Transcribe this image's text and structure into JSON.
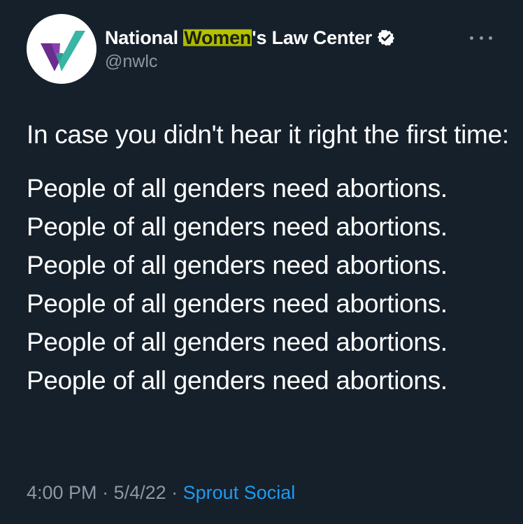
{
  "author": {
    "name_prefix": "National ",
    "name_highlight": "Women",
    "name_suffix": "'s Law Center",
    "handle": "@nwlc",
    "verified": true,
    "avatar_icon": "nwlc-logo-icon"
  },
  "tweet": {
    "intro": "In case you didn't hear it right the first time:",
    "lines": [
      "People of all genders need abortions.",
      "People of all genders need abortions.",
      "People of all genders need abortions.",
      "People of all genders need abortions.",
      "People of all genders need abortions.",
      "People of all genders need abortions."
    ]
  },
  "meta": {
    "time": "4:00 PM",
    "separator": " · ",
    "date": "5/4/22",
    "source": "Sprout Social"
  },
  "colors": {
    "background": "#15202b",
    "text": "#ffffff",
    "secondary": "#8b98a5",
    "link": "#1d9bf0",
    "highlight": "#b8c400",
    "logo_purple": "#6b2c8f",
    "logo_teal": "#3ab5a4"
  }
}
